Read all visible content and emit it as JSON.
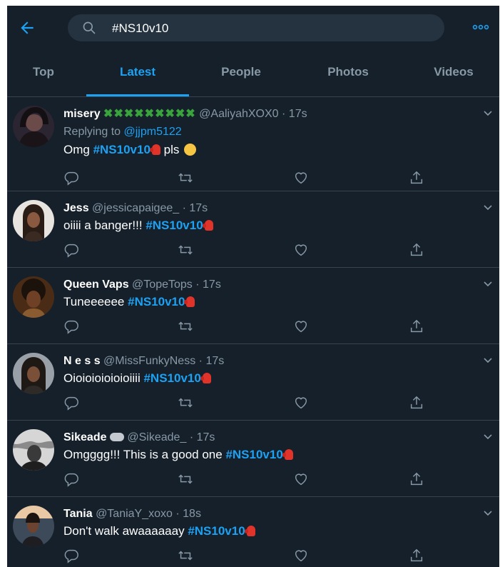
{
  "search": {
    "query": "#NS10v10"
  },
  "tabs": [
    {
      "label": "Top",
      "active": false
    },
    {
      "label": "Latest",
      "active": true
    },
    {
      "label": "People",
      "active": false
    },
    {
      "label": "Photos",
      "active": false
    },
    {
      "label": "Videos",
      "active": false
    }
  ],
  "colors": {
    "background": "#15202b",
    "accent": "#1da1f2",
    "muted": "#8899a6",
    "divider": "#38444d"
  },
  "tweets": [
    {
      "name": "misery",
      "flags": "✖✖✖✖✖✖✖✖✖",
      "handle": "@AaliyahXOX0",
      "time": "17s",
      "replying_label": "Replying to",
      "replying_to": "@jjpm5122",
      "text_before": "Omg",
      "hashtag": "#NS10v10",
      "text_after": "pls"
    },
    {
      "name": "Jess",
      "handle": "@jessicapaigee_",
      "time": "17s",
      "text_before": "oiiii a banger!!!",
      "hashtag": "#NS10v10"
    },
    {
      "name": "Queen Vaps",
      "handle": "@TopeTops",
      "time": "17s",
      "text_before": "Tuneeeeee",
      "hashtag": "#NS10v10"
    },
    {
      "name": "N e s s",
      "handle": "@MissFunkyNess",
      "time": "17s",
      "text_before": "Oioioioioioioiiii",
      "hashtag": "#NS10v10"
    },
    {
      "name": "Sikeade",
      "handle": "@Sikeade_",
      "time": "17s",
      "text_before": "Omgggg!!! This is a good one",
      "hashtag": "#NS10v10"
    },
    {
      "name": "Tania",
      "handle": "@TaniaY_xoxo",
      "time": "18s",
      "text_before": "Don't walk awaaaaaay",
      "hashtag": "#NS10v10"
    }
  ],
  "dot": "·",
  "icons": [
    "back-arrow-icon",
    "search-icon",
    "more-icon",
    "chevron-down-icon",
    "reply-icon",
    "retweet-icon",
    "like-icon",
    "share-icon",
    "boxing-glove-emoji",
    "crying-face-emoji"
  ]
}
